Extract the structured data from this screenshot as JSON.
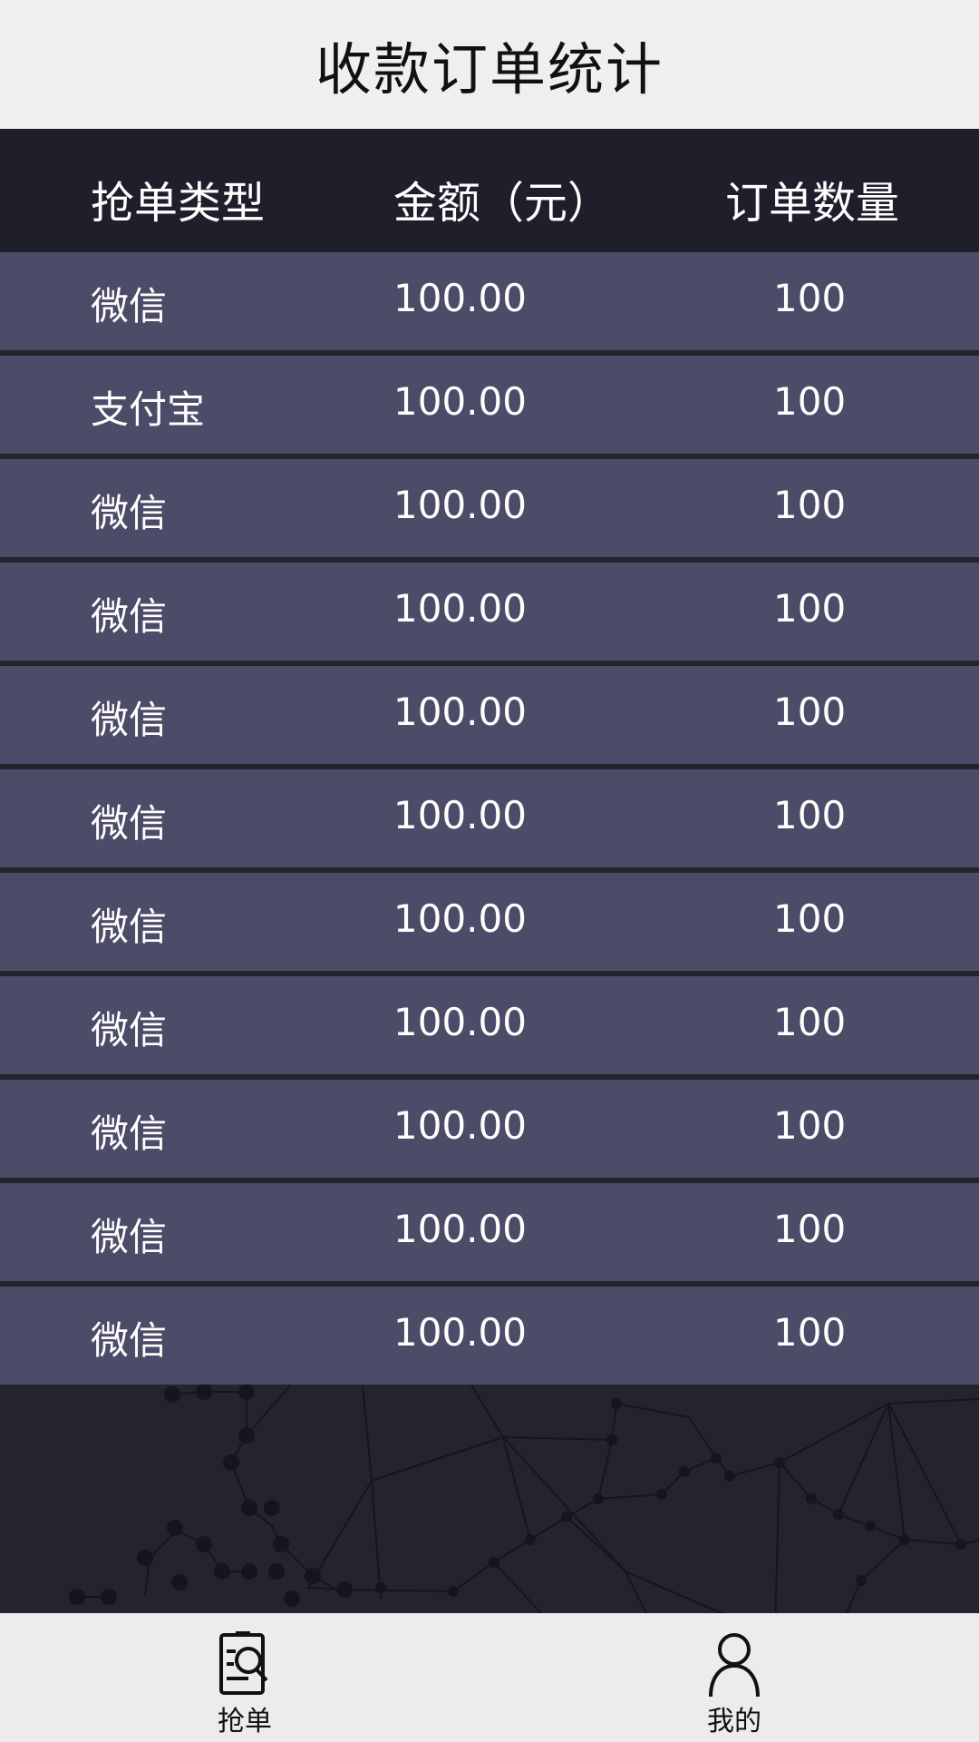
{
  "header": {
    "title": "收款订单统计"
  },
  "table": {
    "columns": [
      "抢单类型",
      "金额（元）",
      "订单数量"
    ],
    "rows": [
      {
        "type": "微信",
        "amount": "100.00",
        "count": "100"
      },
      {
        "type": "支付宝",
        "amount": "100.00",
        "count": "100"
      },
      {
        "type": "微信",
        "amount": "100.00",
        "count": "100"
      },
      {
        "type": "微信",
        "amount": "100.00",
        "count": "100"
      },
      {
        "type": "微信",
        "amount": "100.00",
        "count": "100"
      },
      {
        "type": "微信",
        "amount": "100.00",
        "count": "100"
      },
      {
        "type": "微信",
        "amount": "100.00",
        "count": "100"
      },
      {
        "type": "微信",
        "amount": "100.00",
        "count": "100"
      },
      {
        "type": "微信",
        "amount": "100.00",
        "count": "100"
      },
      {
        "type": "微信",
        "amount": "100.00",
        "count": "100"
      },
      {
        "type": "微信",
        "amount": "100.00",
        "count": "100"
      }
    ]
  },
  "nav": {
    "items": [
      {
        "label": "抢单",
        "icon": "order-search-icon"
      },
      {
        "label": "我的",
        "icon": "user-icon"
      }
    ]
  },
  "colors": {
    "header_bg": "#efefef",
    "background": "#24242f",
    "row_bg": "#4c4c68",
    "text_light": "#ffffff",
    "nav_bg": "#ececec"
  }
}
